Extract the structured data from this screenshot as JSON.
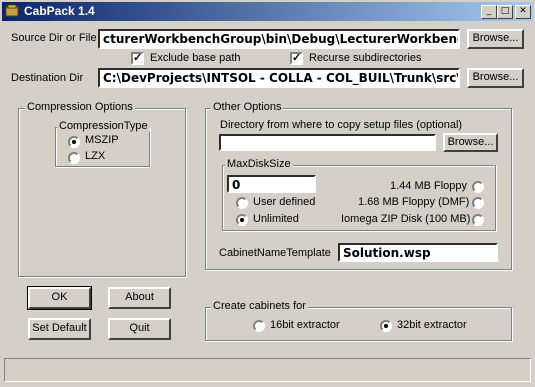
{
  "window": {
    "title": "CabPack 1.4",
    "min_glyph": "_",
    "max_glyph": "□",
    "close_glyph": "✕"
  },
  "source": {
    "label": "Source Dir or File",
    "value": "cturerWorkbenchGroup\\bin\\Debug\\LecturerWorkbenchGroup",
    "browse": "Browse..."
  },
  "options": {
    "exclude_base_path": "Exclude base path",
    "recurse_subdirs": "Recurse subdirectories",
    "check": "✓"
  },
  "destination": {
    "label": "Destination Dir",
    "value": "C:\\DevProjects\\INTSOL - COLLA - COL_BUIL\\Trunk\\src\\Proje",
    "browse": "Browse..."
  },
  "compression": {
    "group_title": "Compression Options",
    "type_title": "CompressionType",
    "mszip": "MSZIP",
    "lzx": "LZX"
  },
  "buttons": {
    "ok": "OK",
    "about": "About",
    "set_default": "Set Default",
    "quit": "Quit"
  },
  "other": {
    "group_title": "Other Options",
    "setup_dir_label": "Directory from where to copy setup files (optional)",
    "setup_dir_value": "",
    "browse": "Browse...",
    "maxdisk_title": "MaxDiskSize",
    "maxdisk_value": "0",
    "user_defined": "User defined",
    "unlimited": "Unlimited",
    "floppy_144": "1.44 MB Floppy",
    "floppy_168": "1.68 MB Floppy (DMF)",
    "iomega_zip": "Iomega ZIP Disk (100 MB)",
    "template_label": "CabinetNameTemplate",
    "template_value": "Solution.wsp"
  },
  "extractor": {
    "group_title": "Create cabinets for",
    "bit16": "16bit extractor",
    "bit32": "32bit extractor"
  }
}
